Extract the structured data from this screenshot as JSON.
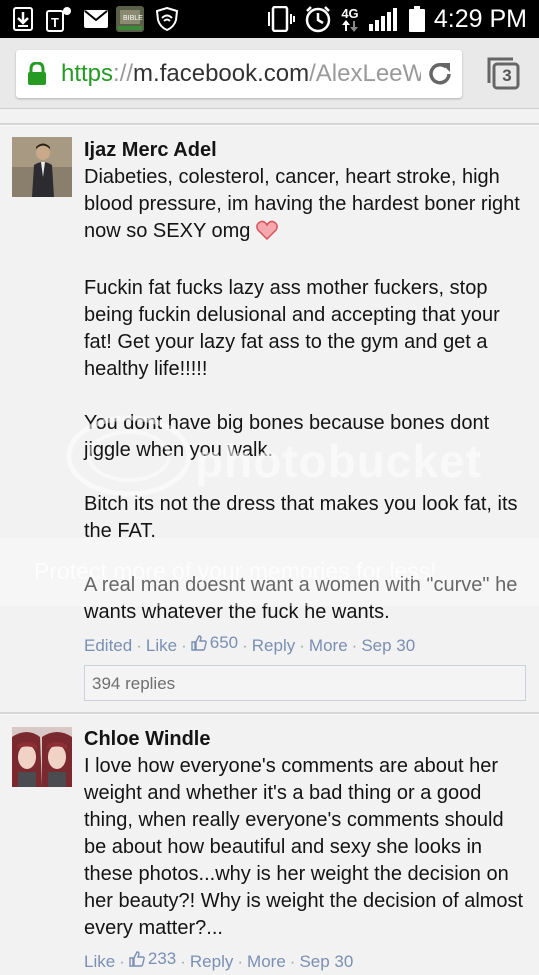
{
  "status_bar": {
    "time": "4:29 PM",
    "network": "4G",
    "icons": [
      "download-icon",
      "t-mobile-icon",
      "mail-icon",
      "bible-app-icon",
      "shield-icon",
      "vibrate-icon",
      "alarm-icon",
      "signal-icon",
      "battery-icon"
    ]
  },
  "browser": {
    "url_scheme": "https",
    "url_sep": "://",
    "url_host": "m.facebook.com",
    "url_path": "/AlexLeeW",
    "tab_count": "3"
  },
  "comments": [
    {
      "author": "Ijaz Merc Adel",
      "paragraphs": [
        "Diabeties, colesterol, cancer, heart stroke, high blood pressure, im having the hardest boner right now so SEXY omg",
        "Fuckin fat fucks lazy ass mother fuckers, stop being fuckin delusional and accepting that your fat! Get your lazy fat ass to the gym and get a healthy life!!!!!",
        "You dont have big bones because bones dont jiggle when you walk.",
        "Bitch its not the dress that makes you look fat, its the FAT.",
        "A real man doesnt want a women with \"curve\" he wants whatever the fuck he wants."
      ],
      "meta": {
        "edited": "Edited",
        "like": "Like",
        "like_count": "650",
        "reply": "Reply",
        "more": "More",
        "date": "Sep 30"
      },
      "replies": "394 replies"
    },
    {
      "author": "Chloe Windle",
      "paragraphs": [
        "I love how everyone's comments are about her weight and whether it's a bad thing or a good thing, when really everyone's comments should be about how beautiful and sexy she looks in these photos...why is her weight the decision on her beauty?! Why is weight the decision of almost every matter?..."
      ],
      "meta": {
        "like": "Like",
        "like_count": "233",
        "reply": "Reply",
        "more": "More",
        "date": "Sep 30"
      }
    }
  ],
  "watermark": {
    "logo_text": "photobucket",
    "banner_text": "Protect more of your memories for less!"
  }
}
